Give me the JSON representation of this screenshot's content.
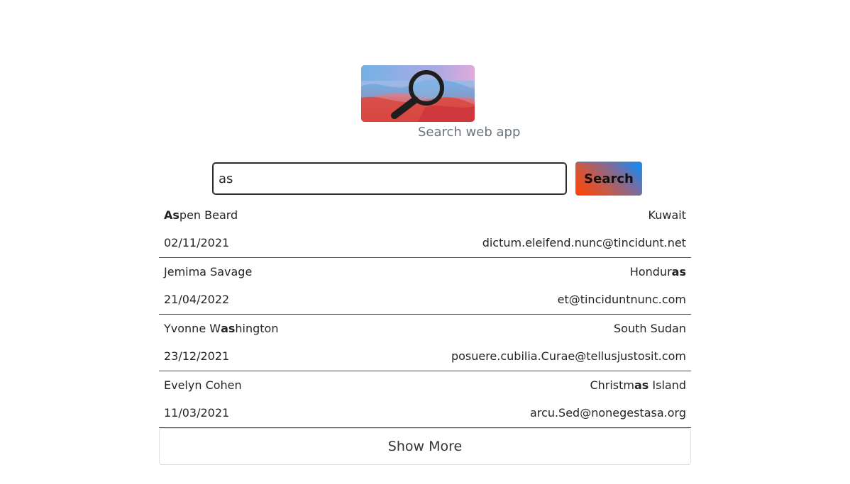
{
  "app": {
    "subtitle": "Search web app",
    "logo_icon": "magnifying-glass-icon"
  },
  "search": {
    "value": "as",
    "button_label": "Search"
  },
  "results": [
    {
      "name": {
        "hl": "As",
        "pre": "",
        "post": "pen Beard"
      },
      "country": {
        "pre": "Kuwait",
        "hl": "",
        "post": ""
      },
      "date": "02/11/2021",
      "email": "dictum.eleifend.nunc@tincidunt.net"
    },
    {
      "name": {
        "pre": "Jemima Savage",
        "hl": "",
        "post": ""
      },
      "country": {
        "pre": "Hondur",
        "hl": "as",
        "post": ""
      },
      "date": "21/04/2022",
      "email": "et@tinciduntnunc.com"
    },
    {
      "name": {
        "pre": "Yvonne W",
        "hl": "as",
        "post": "hington"
      },
      "country": {
        "pre": "South Sudan",
        "hl": "",
        "post": ""
      },
      "date": "23/12/2021",
      "email": "posuere.cubilia.Curae@tellusjustosit.com"
    },
    {
      "name": {
        "pre": "Evelyn Cohen",
        "hl": "",
        "post": ""
      },
      "country": {
        "pre": "Christm",
        "hl": "as",
        "post": " Island"
      },
      "date": "11/03/2021",
      "email": "arcu.Sed@nonegestasa.org"
    }
  ],
  "show_more_label": "Show More",
  "colors": {
    "subtitle": "#6c757d",
    "button_gradient_start": "#ff4200",
    "button_gradient_end": "#0091ff",
    "divider": "#4a4a4a"
  }
}
